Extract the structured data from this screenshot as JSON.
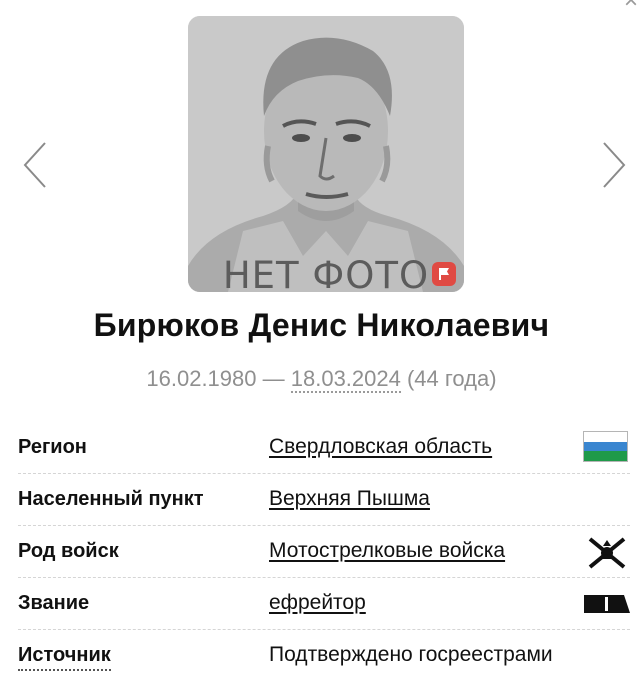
{
  "profile": {
    "photo_placeholder": "НЕТ ФОТО",
    "name": "Бирюков Денис Николаевич",
    "birth_date": "16.02.1980",
    "separator": "—",
    "death_date": "18.03.2024",
    "age": "(44 года)"
  },
  "navigation": {
    "prev_icon": "chevron-left-icon",
    "next_icon": "chevron-right-icon",
    "close_icon": "close-icon"
  },
  "details": [
    {
      "label": "Регион",
      "value": "Свердловская область",
      "icon": "region-flag-icon"
    },
    {
      "label": "Населенный пункт",
      "value": "Верхняя Пышма",
      "icon": ""
    },
    {
      "label": "Род войск",
      "value": "Мотострелковые войска",
      "icon": "branch-emblem-icon"
    },
    {
      "label": "Звание",
      "value": "ефрейтор",
      "icon": "rank-insignia-icon"
    },
    {
      "label": "Источник",
      "value": "Подтверждено госреестрами",
      "icon": ""
    }
  ],
  "colors": {
    "flag_top": "#ffffff",
    "flag_middle": "#3a86d0",
    "flag_bottom": "#1f9a4a",
    "report_flag": "#e04a43",
    "muted_text": "#8f8f8f"
  }
}
